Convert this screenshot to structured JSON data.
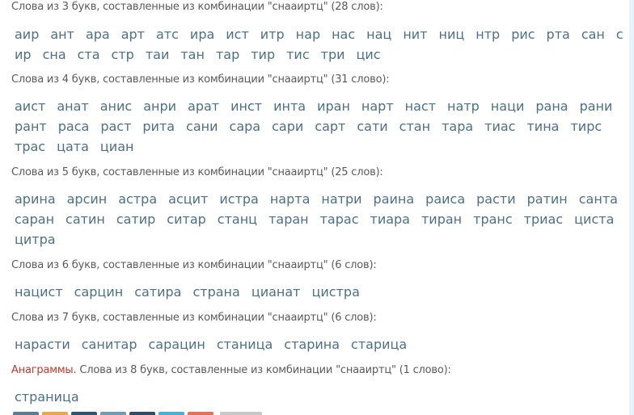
{
  "combination": "снааиртц",
  "groups": [
    {
      "prefix": "",
      "header": "Слова из 3 букв, составленные из комбинации \"снааиртц\" (28 слов):",
      "words": [
        "аир",
        "ант",
        "ара",
        "арт",
        "атс",
        "ира",
        "ист",
        "итр",
        "нар",
        "нас",
        "нац",
        "нит",
        "ниц",
        "нтр",
        "рис",
        "рта",
        "сан",
        "с",
        "ир",
        "сна",
        "ста",
        "стр",
        "таи",
        "тан",
        "тар",
        "тир",
        "тис",
        "три",
        "цис"
      ]
    },
    {
      "prefix": "",
      "header": "Слова из 4 букв, составленные из комбинации \"снааиртц\" (31 слово):",
      "words": [
        "аист",
        "анат",
        "анис",
        "анри",
        "арат",
        "инст",
        "инта",
        "иран",
        "нарт",
        "наст",
        "натр",
        "наци",
        "рана",
        "рани",
        "рант",
        "раса",
        "раст",
        "рита",
        "сани",
        "сара",
        "сари",
        "сарт",
        "сати",
        "стан",
        "тара",
        "тиас",
        "тина",
        "тирс",
        "трас",
        "цата",
        "циан"
      ]
    },
    {
      "prefix": "",
      "header": "Слова из 5 букв, составленные из комбинации \"снааиртц\" (25 слов):",
      "words": [
        "арина",
        "арсин",
        "астра",
        "асцит",
        "истра",
        "нарта",
        "натри",
        "раина",
        "раиса",
        "расти",
        "ратин",
        "санта",
        "саран",
        "сатин",
        "сатир",
        "ситар",
        "станц",
        "таран",
        "тарас",
        "тиара",
        "тиран",
        "транс",
        "триас",
        "циста",
        "цитра"
      ]
    },
    {
      "prefix": "",
      "header": "Слова из 6 букв, составленные из комбинации \"снааиртц\" (6 слов):",
      "words": [
        "нацист",
        "сарцин",
        "сатира",
        "страна",
        "цианат",
        "цистра"
      ]
    },
    {
      "prefix": "",
      "header": "Слова из 7 букв, составленные из комбинации \"снааиртц\" (6 слов):",
      "words": [
        "нарасти",
        "санитар",
        "сарацин",
        "станица",
        "старина",
        "старица"
      ]
    },
    {
      "prefix": "Анаграммы",
      "header": ". Слова из 8 букв, составленные из комбинации \"снааиртц\" (1 слово):",
      "words": [
        "страница"
      ]
    }
  ],
  "share_buttons": [
    {
      "icon": "share-vk-icon",
      "color": "#5d7a96"
    },
    {
      "icon": "share-ok-icon",
      "color": "#e8a94a"
    },
    {
      "icon": "share-facebook-icon",
      "color": "#2f5670"
    },
    {
      "icon": "share-twitter-icon",
      "color": "#6e9cb4"
    },
    {
      "icon": "share-mailru-icon",
      "color": "#2e4d6a"
    },
    {
      "icon": "share-telegram-icon",
      "color": "#46b1d6"
    },
    {
      "icon": "share-google-icon",
      "color": "#e47256"
    },
    {
      "icon": "share-more-icon",
      "color": "#c8c8c8"
    }
  ]
}
